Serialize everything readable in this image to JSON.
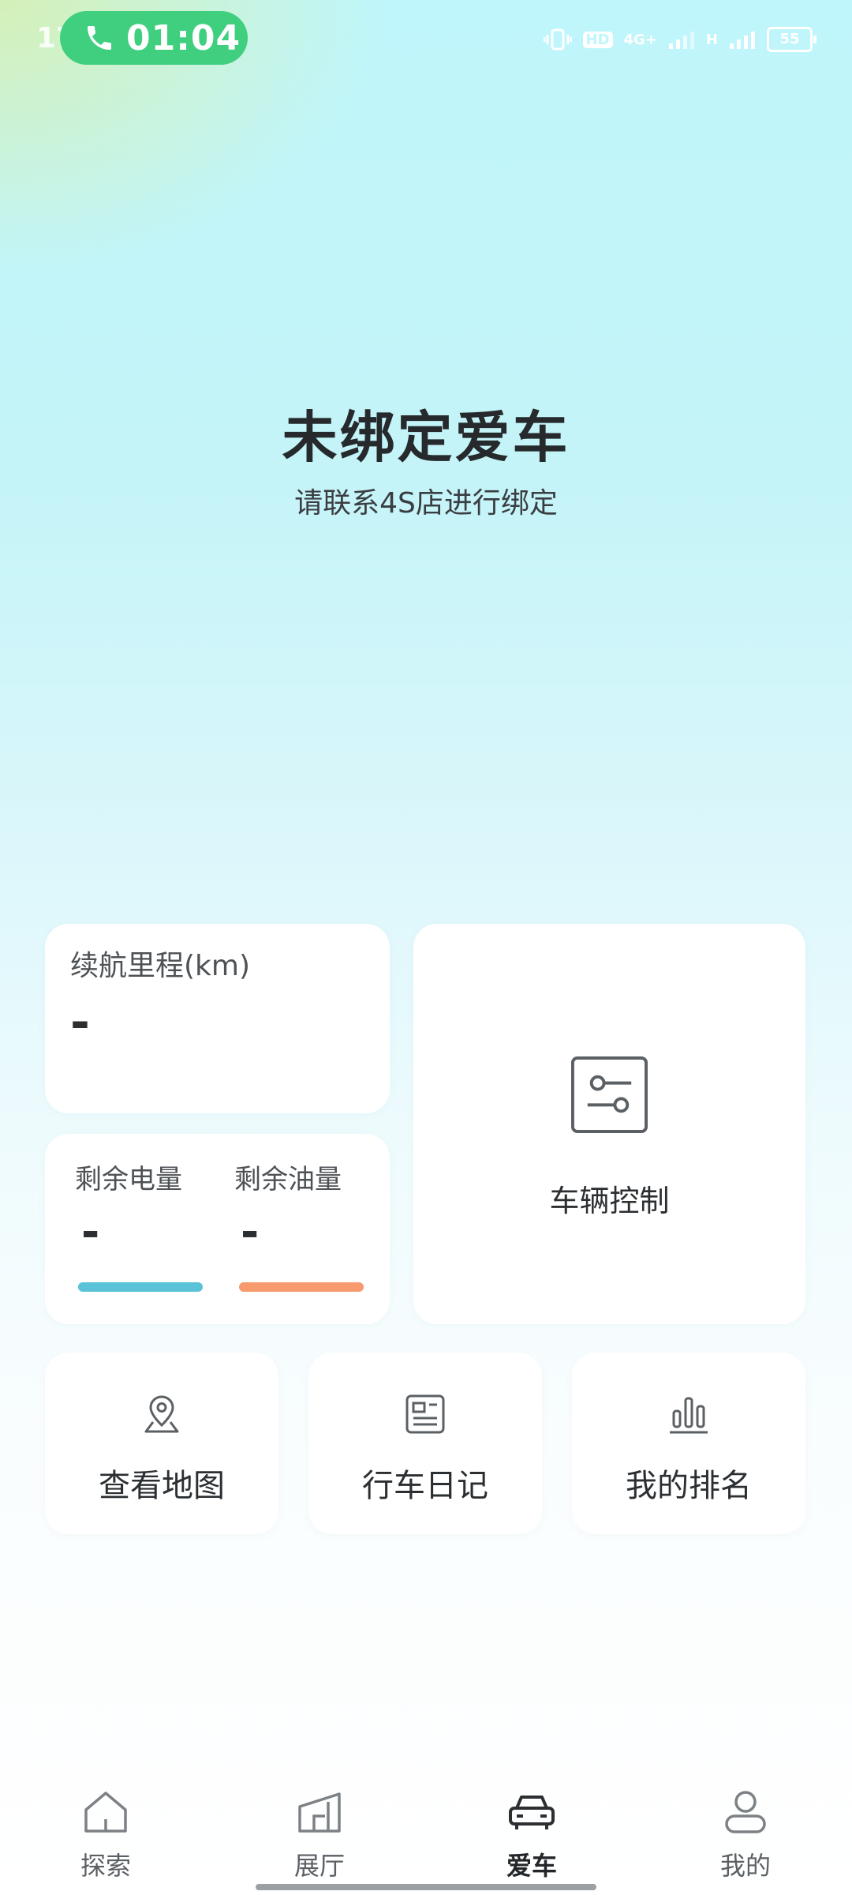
{
  "status_bar": {
    "clock": "17:50",
    "call_timer": "01:04",
    "network_label": "4G+",
    "hd_label": "HD",
    "signal_label": "H",
    "battery": "55"
  },
  "hero": {
    "title": "未绑定爱车",
    "subtitle": "请联系4S店进行绑定"
  },
  "range_card": {
    "label": "续航里程(km)",
    "value": "-"
  },
  "energy_card": {
    "battery_label": "剩余电量",
    "battery_value": "-",
    "fuel_label": "剩余油量",
    "fuel_value": "-",
    "battery_color": "#5bc3d8",
    "fuel_color": "#f79a6e"
  },
  "control_card": {
    "label": "车辆控制"
  },
  "quick_actions": {
    "map_label": "查看地图",
    "diary_label": "行车日记",
    "rank_label": "我的排名"
  },
  "bottom_nav": {
    "items": [
      {
        "label": "探索",
        "icon": "home-icon"
      },
      {
        "label": "展厅",
        "icon": "showroom-icon"
      },
      {
        "label": "爱车",
        "icon": "car-icon",
        "active": true
      },
      {
        "label": "我的",
        "icon": "profile-icon"
      }
    ]
  },
  "colors": {
    "call_pill": "#3fcf7f",
    "text_primary": "#262a2d"
  }
}
